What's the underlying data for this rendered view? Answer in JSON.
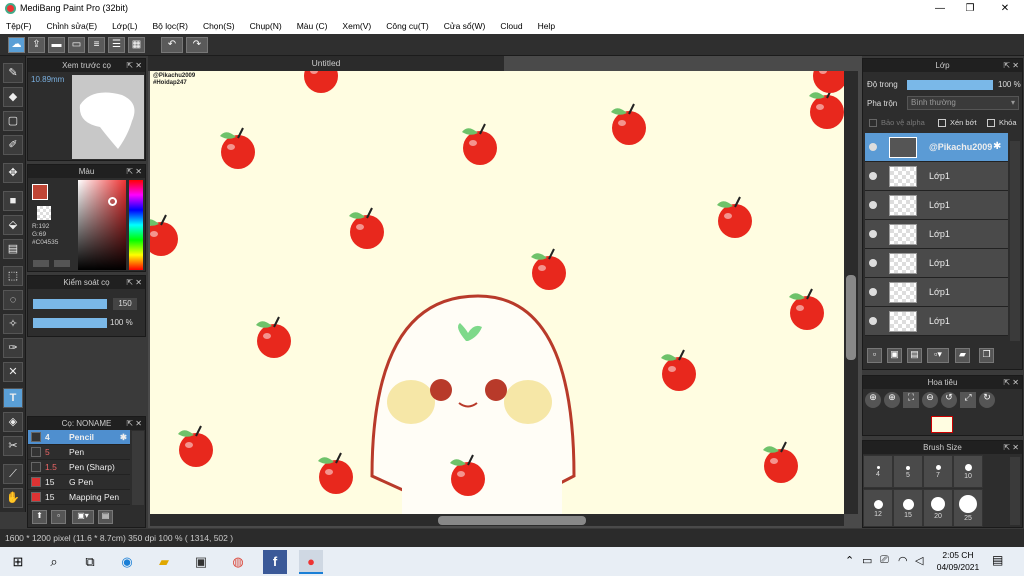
{
  "window": {
    "title": "MediBang Paint Pro (32bit)",
    "minimize": "—",
    "maximize": "❐",
    "close": "✕"
  },
  "menu": [
    "Tệp(F)",
    "Chỉnh sửa(E)",
    "Lớp(L)",
    "Bộ lọc(R)",
    "Chọn(S)",
    "Chụp(N)",
    "Màu (C)",
    "Xem(V)",
    "Công cụ(T)",
    "Cửa sổ(W)",
    "Cloud",
    "Help"
  ],
  "toolbar": {
    "icons": [
      "cloud-icon",
      "share-icon",
      "comment-icon",
      "chat-icon",
      "document-icon",
      "list-icon",
      "grid-icon"
    ],
    "undo": "↶",
    "redo": "↷"
  },
  "preview": {
    "title": "Xem trước cọ",
    "size": "10.89mm"
  },
  "color": {
    "title": "Màu",
    "r": "R:192",
    "g": "G:69",
    "hex": "#C04535",
    "current": "#c04535"
  },
  "brush_control": {
    "title": "Kiểm soát cọ",
    "size_value": "150",
    "opacity_value": "100 %",
    "size_fraction": 1.0,
    "opacity_fraction": 1.0
  },
  "brushes": {
    "title": "Cọ: NONAME",
    "items": [
      {
        "num": "4",
        "name": "Pencil",
        "color": "#333333",
        "selected": true
      },
      {
        "num": "5",
        "name": "Pen",
        "color": "#333333"
      },
      {
        "num": "1.5",
        "name": "Pen (Sharp)",
        "color": "#333333"
      },
      {
        "num": "15",
        "name": "G Pen",
        "color": "#d33"
      },
      {
        "num": "15",
        "name": "Mapping Pen",
        "color": "#d33"
      }
    ]
  },
  "canvas": {
    "tab": "Untitled",
    "watermark_line1": "@Pikachu2009",
    "watermark_line2": "#Hoidap247"
  },
  "layers": {
    "title": "Lớp",
    "opacity_label": "Độ trong",
    "opacity_value": "100 %",
    "blend_label": "Pha trộn",
    "blend_value": "Bình thường",
    "protect_alpha": "Bảo vệ alpha",
    "clipping": "Xén bớt",
    "lock": "Khóa",
    "items": [
      {
        "name": "@Pikachu2009",
        "selected": true
      },
      {
        "name": "Lớp1"
      },
      {
        "name": "Lớp1"
      },
      {
        "name": "Lớp1"
      },
      {
        "name": "Lớp1"
      },
      {
        "name": "Lớp1"
      },
      {
        "name": "Lớp1"
      }
    ]
  },
  "navigator": {
    "title": "Hoa tiêu"
  },
  "brush_size": {
    "title": "Brush Size",
    "sizes": [
      "4",
      "5",
      "7",
      "10",
      "12",
      "15",
      "20",
      "25"
    ]
  },
  "status": {
    "text": "1600 * 1200 pixel   (11.6 * 8.7cm)   350 dpi   100 %   ( 1314, 502 )"
  },
  "taskbar": {
    "time": "2:05 CH",
    "date": "04/09/2021"
  }
}
